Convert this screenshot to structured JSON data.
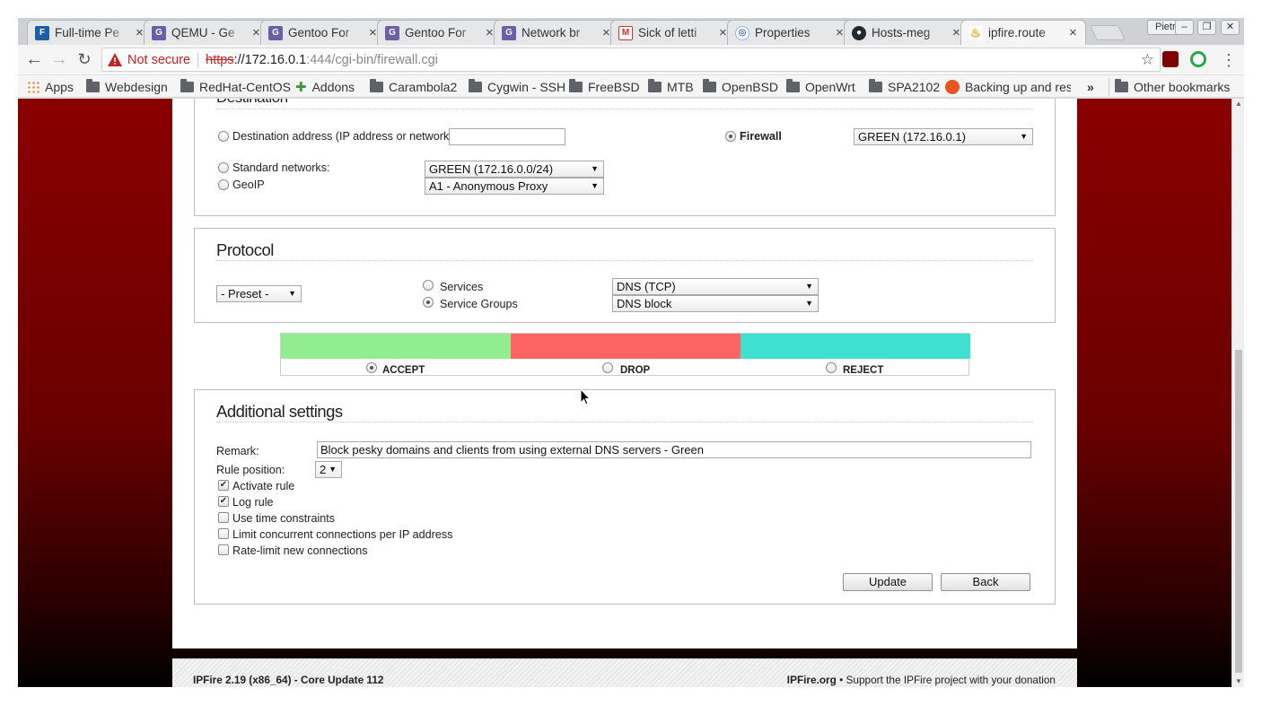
{
  "browser": {
    "tabs": [
      {
        "title": "Full-time Pe",
        "favicon": "document-icon",
        "color": "#1a5fa8"
      },
      {
        "title": "QEMU - Ge",
        "favicon": "gentoo-forum-icon",
        "color": "#6c5ea8"
      },
      {
        "title": "Gentoo For",
        "favicon": "gentoo-forum-icon",
        "color": "#6c5ea8"
      },
      {
        "title": "Gentoo For",
        "favicon": "gentoo-forum-icon",
        "color": "#6c5ea8"
      },
      {
        "title": "Network br",
        "favicon": "gentoo-forum-icon",
        "color": "#6c5ea8"
      },
      {
        "title": "Sick of letti",
        "favicon": "gmail-icon",
        "color": "#d93025"
      },
      {
        "title": "Properties",
        "favicon": "globe-icon",
        "color": "#8ab4f8"
      },
      {
        "title": "Hosts-meg",
        "favicon": "github-icon",
        "color": "#24292e"
      },
      {
        "title": "ipfire.route",
        "favicon": "ipfire-icon",
        "color": "#e8a300",
        "active": true
      }
    ],
    "profile_name": "Pietro",
    "window_buttons": [
      "minimize",
      "restore",
      "close"
    ],
    "address": {
      "security_label": "Not secure",
      "scheme": "https",
      "host": "://172.16.0.1",
      "path": ":444/cgi-bin/firewall.cgi"
    },
    "bookmarks": [
      {
        "label": "Apps",
        "icon": "apps-grid-icon"
      },
      {
        "label": "Webdesign",
        "icon": "folder-icon"
      },
      {
        "label": "RedHat-CentOS",
        "icon": "folder-icon"
      },
      {
        "label": "Addons",
        "icon": "puzzle-icon"
      },
      {
        "label": "Carambola2",
        "icon": "folder-icon"
      },
      {
        "label": "Cygwin - SSH",
        "icon": "folder-icon"
      },
      {
        "label": "FreeBSD",
        "icon": "folder-icon"
      },
      {
        "label": "MTB",
        "icon": "folder-icon"
      },
      {
        "label": "OpenBSD",
        "icon": "folder-icon"
      },
      {
        "label": "OpenWrt",
        "icon": "folder-icon"
      },
      {
        "label": "SPA2102",
        "icon": "folder-icon"
      },
      {
        "label": "Backing up and res",
        "icon": "ubuntu-icon"
      }
    ],
    "bookmarks_overflow": "»",
    "other_bookmarks": "Other bookmarks"
  },
  "destination": {
    "title": "Destination",
    "dest_address_label": "Destination address (IP address or network):",
    "dest_address_value": "",
    "firewall_label": "Firewall",
    "firewall_select": "GREEN (172.16.0.1)",
    "standard_networks_label": "Standard networks:",
    "standard_networks_select": "GREEN (172.16.0.0/24)",
    "geoip_label": "GeoIP",
    "geoip_select": "A1 - Anonymous Proxy"
  },
  "protocol": {
    "title": "Protocol",
    "preset_select": "- Preset -",
    "services_label": "Services",
    "services_select": "DNS (TCP)",
    "service_groups_label": "Service Groups",
    "service_groups_select": "DNS block"
  },
  "actions": [
    {
      "label": "ACCEPT",
      "color": "#90ee90",
      "selected": true
    },
    {
      "label": "DROP",
      "color": "#ff6464",
      "selected": false
    },
    {
      "label": "REJECT",
      "color": "#40e0d0",
      "selected": false
    }
  ],
  "additional": {
    "title": "Additional settings",
    "remark_label": "Remark:",
    "remark_value": "Block pesky domains and clients from using external DNS servers - Green",
    "rule_position_label": "Rule position:",
    "rule_position_value": "2",
    "options": [
      {
        "label": "Activate rule",
        "checked": true
      },
      {
        "label": "Log rule",
        "checked": true
      },
      {
        "label": "Use time constraints",
        "checked": false
      },
      {
        "label": "Limit concurrent connections per IP address",
        "checked": false
      },
      {
        "label": "Rate-limit new connections",
        "checked": false
      }
    ],
    "update_label": "Update",
    "back_label": "Back"
  },
  "footer": {
    "version": "IPFire 2.19 (x86_64) - Core Update 112",
    "site": "IPFire.org",
    "support": " • Support the IPFire project with your donation"
  }
}
